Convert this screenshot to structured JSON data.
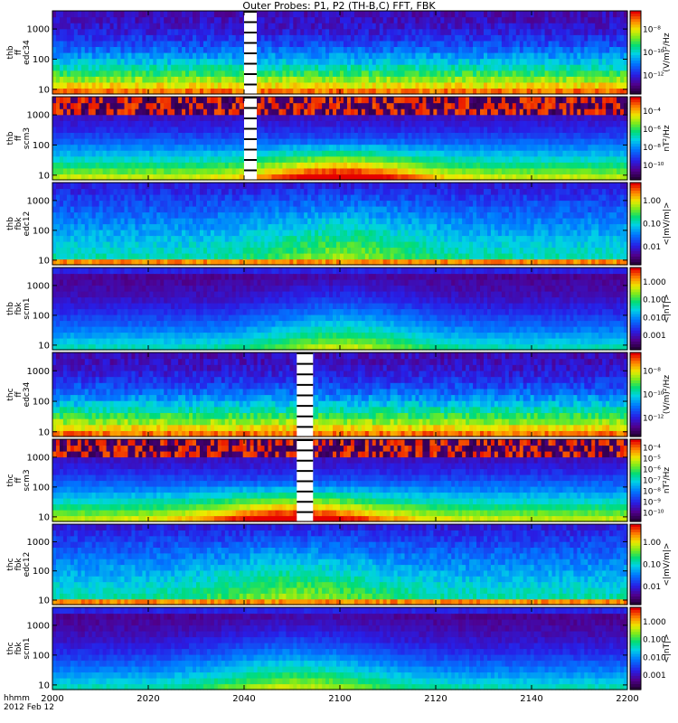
{
  "title": "Outer Probes: P1, P2 (TH-B,C) FFT, FBK",
  "x_axis": {
    "label_top": "hhmm",
    "label_bottom": "2012 Feb 12",
    "ticks": [
      "2000",
      "2020",
      "2040",
      "2100",
      "2120",
      "2140",
      "2200"
    ]
  },
  "chart_data": [
    {
      "type": "heatmap",
      "ylabel": [
        "thb",
        "ff",
        "edc34"
      ],
      "yscale": "log",
      "yticks": [
        "10",
        "100",
        "1000"
      ],
      "colorbar_label": "(V/m)²/Hz",
      "colorbar_ticks": [
        "10⁻⁸",
        "10⁻¹⁰",
        "10⁻¹²"
      ],
      "cmax": "10⁻⁷",
      "cmin": "10⁻¹³"
    },
    {
      "type": "heatmap",
      "ylabel": [
        "thb",
        "ff",
        "scm3"
      ],
      "yscale": "log",
      "yticks": [
        "10",
        "100",
        "1000"
      ],
      "colorbar_label": "nT²/Hz",
      "colorbar_ticks": [
        "10⁻⁴",
        "10⁻⁶",
        "10⁻⁸",
        "10⁻¹⁰"
      ],
      "cmax": "10⁻³",
      "cmin": "10⁻¹⁰"
    },
    {
      "type": "heatmap",
      "ylabel": [
        "thb",
        "fbk",
        "edc12"
      ],
      "yscale": "log",
      "yticks": [
        "10",
        "100",
        "1000"
      ],
      "colorbar_label": "<|mV/m|>",
      "colorbar_ticks": [
        "1.00",
        "0.10",
        "0.01"
      ],
      "cmax": "1.5",
      "cmin": "0.005"
    },
    {
      "type": "heatmap",
      "ylabel": [
        "thb",
        "fbk",
        "scm1"
      ],
      "yscale": "log",
      "yticks": [
        "10",
        "100",
        "1000"
      ],
      "colorbar_label": "<|nT|>",
      "colorbar_ticks": [
        "1.000",
        "0.100",
        "0.010",
        "0.001"
      ],
      "cmax": "1.0",
      "cmin": "0.001"
    },
    {
      "type": "heatmap",
      "ylabel": [
        "thc",
        "ff",
        "edc34"
      ],
      "yscale": "log",
      "yticks": [
        "10",
        "100",
        "1000"
      ],
      "colorbar_label": "(V/m)²/Hz",
      "colorbar_ticks": [
        "10⁻⁸",
        "10⁻¹⁰",
        "10⁻¹²"
      ],
      "cmax": "10⁻⁷",
      "cmin": "10⁻¹³"
    },
    {
      "type": "heatmap",
      "ylabel": [
        "thc",
        "ff",
        "scm3"
      ],
      "yscale": "log",
      "yticks": [
        "10",
        "100",
        "1000"
      ],
      "colorbar_label": "nT²/Hz",
      "colorbar_ticks": [
        "10⁻⁴",
        "10⁻⁵",
        "10⁻⁶",
        "10⁻⁷",
        "10⁻⁸",
        "10⁻⁹",
        "10⁻¹⁰"
      ],
      "cmax": "10⁻⁴",
      "cmin": "10⁻¹⁰"
    },
    {
      "type": "heatmap",
      "ylabel": [
        "thc",
        "fbk",
        "edc12"
      ],
      "yscale": "log",
      "yticks": [
        "10",
        "100",
        "1000"
      ],
      "colorbar_label": "<|mV/m|>",
      "colorbar_ticks": [
        "1.00",
        "0.10",
        "0.01"
      ],
      "cmax": "1.5",
      "cmin": "0.005"
    },
    {
      "type": "heatmap",
      "ylabel": [
        "thc",
        "fbk",
        "scm1"
      ],
      "yscale": "log",
      "yticks": [
        "10",
        "100",
        "1000"
      ],
      "colorbar_label": "<|nT|>",
      "colorbar_ticks": [
        "1.000",
        "0.100",
        "0.010",
        "0.001"
      ],
      "cmax": "1.0",
      "cmin": "0.001"
    }
  ]
}
